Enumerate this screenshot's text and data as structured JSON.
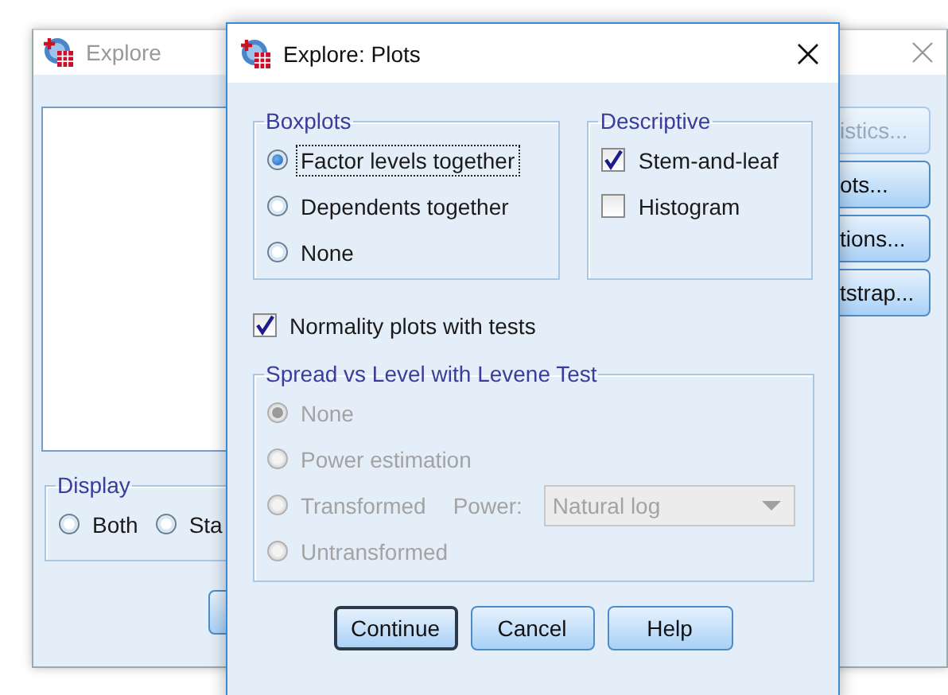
{
  "background_window": {
    "title": "Explore",
    "display": {
      "legend": "Display",
      "options": [
        {
          "label": "Both",
          "selected": false
        },
        {
          "label": "Sta",
          "selected": false
        }
      ]
    },
    "side_buttons": [
      {
        "label": "istics...",
        "disabled": true
      },
      {
        "label": "ots...",
        "disabled": false
      },
      {
        "label": "tions...",
        "disabled": false
      },
      {
        "label": "tstrap...",
        "disabled": false
      }
    ]
  },
  "dialog": {
    "title": "Explore: Plots",
    "boxplots": {
      "legend": "Boxplots",
      "options": [
        {
          "label": "Factor levels together",
          "selected": true,
          "focused": true
        },
        {
          "label": "Dependents together",
          "selected": false,
          "focused": false
        },
        {
          "label": "None",
          "selected": false,
          "focused": false
        }
      ]
    },
    "descriptive": {
      "legend": "Descriptive",
      "items": [
        {
          "label": "Stem-and-leaf",
          "checked": true
        },
        {
          "label": "Histogram",
          "checked": false
        }
      ]
    },
    "normality": {
      "label": "Normality plots with tests",
      "checked": true
    },
    "spread": {
      "legend": "Spread vs Level with Levene Test",
      "disabled": true,
      "options": [
        {
          "kind": "radio",
          "label": "None",
          "selected": true
        },
        {
          "kind": "radio",
          "label": "Power estimation",
          "selected": false
        },
        {
          "kind": "radio-power",
          "label": "Transformed",
          "selected": false,
          "power_label": "Power:",
          "power_value": "Natural log"
        },
        {
          "kind": "radio",
          "label": "Untransformed",
          "selected": false
        }
      ]
    },
    "buttons": [
      {
        "label": "Continue",
        "default": true
      },
      {
        "label": "Cancel",
        "default": false
      },
      {
        "label": "Help",
        "default": false
      }
    ]
  }
}
